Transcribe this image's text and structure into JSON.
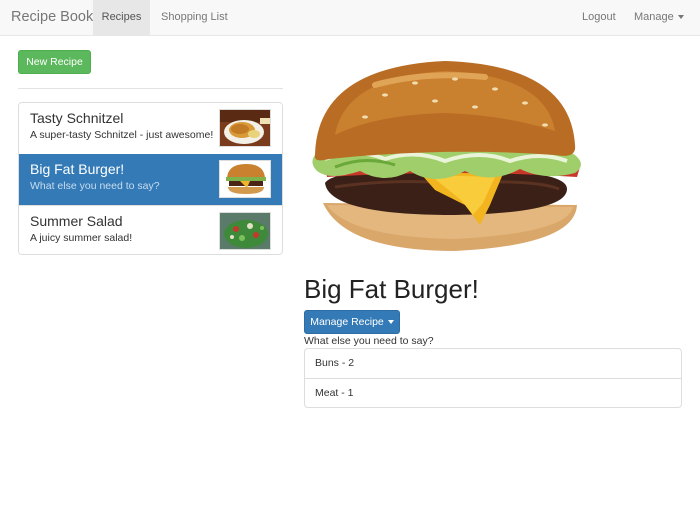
{
  "navbar": {
    "brand": "Recipe Book",
    "recipes": "Recipes",
    "shopping_list": "Shopping List",
    "logout": "Logout",
    "manage": "Manage"
  },
  "new_recipe_label": "New Recipe",
  "recipes": [
    {
      "name": "Tasty Schnitzel",
      "description": "A super-tasty Schnitzel - just awesome!",
      "active": false
    },
    {
      "name": "Big Fat Burger!",
      "description": "What else you need to say?",
      "active": true
    },
    {
      "name": "Summer Salad",
      "description": "A juicy summer salad!",
      "active": false
    }
  ],
  "detail": {
    "title": "Big Fat Burger!",
    "manage_recipe_label": "Manage Recipe",
    "description": "What else you need to say?",
    "ingredients": [
      {
        "text": "Buns - 2"
      },
      {
        "text": "Meat - 1"
      }
    ]
  },
  "colors": {
    "primary": "#337ab7",
    "success": "#5cb85c",
    "navbar_bg": "#f8f8f8"
  }
}
